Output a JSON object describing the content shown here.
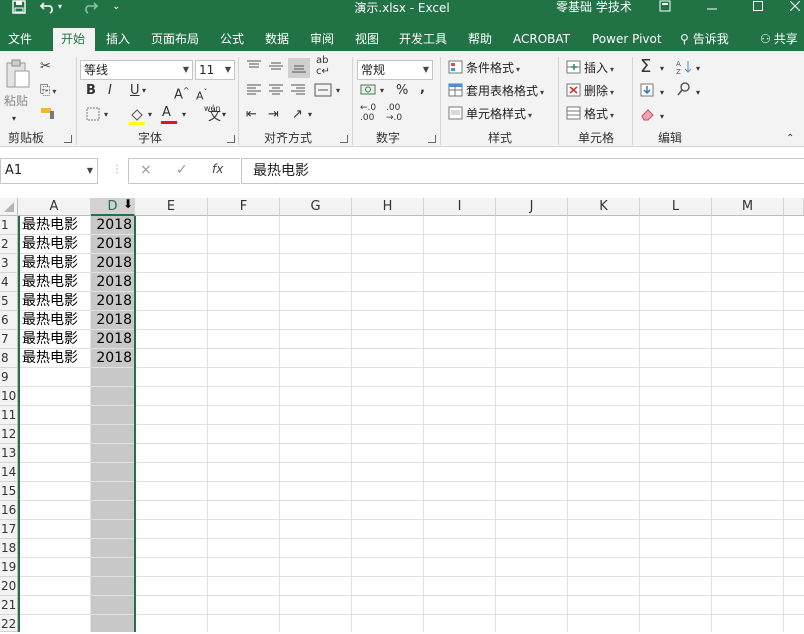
{
  "titlebar": {
    "title": "演示.xlsx - Excel",
    "account": "零基础 学技术",
    "save_icon": "save-icon",
    "undo_icon": "undo-icon"
  },
  "menu": {
    "tabs": [
      "文件",
      "开始",
      "插入",
      "页面布局",
      "公式",
      "数据",
      "审阅",
      "视图",
      "开发工具",
      "帮助",
      "ACROBAT",
      "Power Pivot"
    ],
    "active": "开始",
    "tell_me": "告诉我",
    "share": "共享"
  },
  "ribbon": {
    "clipboard": {
      "paste": "粘贴",
      "label": "剪贴板"
    },
    "font": {
      "name": "等线",
      "size": "11",
      "bold": "B",
      "italic": "I",
      "underline": "U",
      "grow": "A",
      "shrink": "A",
      "color": "A",
      "phonetic": "wén",
      "label": "字体"
    },
    "alignment": {
      "wrap": "ab↵c",
      "label": "对齐方式"
    },
    "number": {
      "format": "常规",
      "percent": "%",
      "comma": ",",
      "label": "数字"
    },
    "styles": {
      "conditional": "条件格式",
      "table": "套用表格格式",
      "cell": "单元格样式",
      "label": "样式"
    },
    "cells": {
      "insert": "插入",
      "delete": "删除",
      "format": "格式",
      "label": "单元格"
    },
    "editing": {
      "sum": "Σ",
      "label": "编辑"
    }
  },
  "formula_bar": {
    "name_box": "A1",
    "cancel": "×",
    "enter": "✓",
    "fx": "fx",
    "value": "最热电影"
  },
  "sheet": {
    "columns": [
      "A",
      "D",
      "E",
      "F",
      "G",
      "H",
      "I",
      "J",
      "K",
      "L",
      "M"
    ],
    "selected_column": "D",
    "rows": [
      "1",
      "2",
      "3",
      "4",
      "5",
      "6",
      "7",
      "8",
      "9",
      "10",
      "11",
      "12",
      "13",
      "14",
      "15",
      "16",
      "17",
      "18",
      "19",
      "20",
      "21",
      "22"
    ],
    "data": [
      [
        "最热电影",
        "2018"
      ],
      [
        "最热电影",
        "2018"
      ],
      [
        "最热电影",
        "2018"
      ],
      [
        "最热电影",
        "2018"
      ],
      [
        "最热电影",
        "2018"
      ],
      [
        "最热电影",
        "2018"
      ],
      [
        "最热电影",
        "2018"
      ],
      [
        "最热电影",
        "2018"
      ]
    ],
    "selection_color": "#c8c8c8",
    "accent": "#217346"
  }
}
